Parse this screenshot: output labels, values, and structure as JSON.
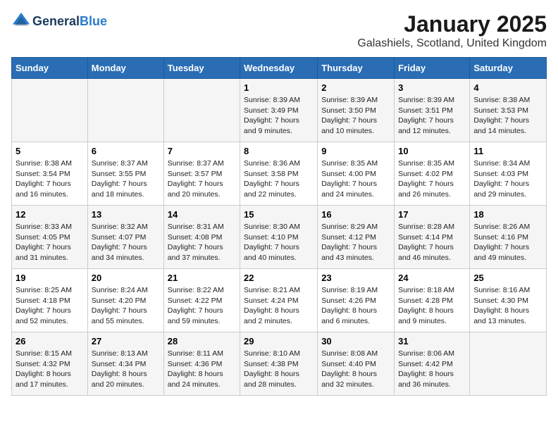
{
  "header": {
    "logo_general": "General",
    "logo_blue": "Blue",
    "month": "January 2025",
    "location": "Galashiels, Scotland, United Kingdom"
  },
  "weekdays": [
    "Sunday",
    "Monday",
    "Tuesday",
    "Wednesday",
    "Thursday",
    "Friday",
    "Saturday"
  ],
  "weeks": [
    [
      {
        "date": "",
        "sunrise": "",
        "sunset": "",
        "daylight": ""
      },
      {
        "date": "",
        "sunrise": "",
        "sunset": "",
        "daylight": ""
      },
      {
        "date": "",
        "sunrise": "",
        "sunset": "",
        "daylight": ""
      },
      {
        "date": "1",
        "sunrise": "Sunrise: 8:39 AM",
        "sunset": "Sunset: 3:49 PM",
        "daylight": "Daylight: 7 hours and 9 minutes."
      },
      {
        "date": "2",
        "sunrise": "Sunrise: 8:39 AM",
        "sunset": "Sunset: 3:50 PM",
        "daylight": "Daylight: 7 hours and 10 minutes."
      },
      {
        "date": "3",
        "sunrise": "Sunrise: 8:39 AM",
        "sunset": "Sunset: 3:51 PM",
        "daylight": "Daylight: 7 hours and 12 minutes."
      },
      {
        "date": "4",
        "sunrise": "Sunrise: 8:38 AM",
        "sunset": "Sunset: 3:53 PM",
        "daylight": "Daylight: 7 hours and 14 minutes."
      }
    ],
    [
      {
        "date": "5",
        "sunrise": "Sunrise: 8:38 AM",
        "sunset": "Sunset: 3:54 PM",
        "daylight": "Daylight: 7 hours and 16 minutes."
      },
      {
        "date": "6",
        "sunrise": "Sunrise: 8:37 AM",
        "sunset": "Sunset: 3:55 PM",
        "daylight": "Daylight: 7 hours and 18 minutes."
      },
      {
        "date": "7",
        "sunrise": "Sunrise: 8:37 AM",
        "sunset": "Sunset: 3:57 PM",
        "daylight": "Daylight: 7 hours and 20 minutes."
      },
      {
        "date": "8",
        "sunrise": "Sunrise: 8:36 AM",
        "sunset": "Sunset: 3:58 PM",
        "daylight": "Daylight: 7 hours and 22 minutes."
      },
      {
        "date": "9",
        "sunrise": "Sunrise: 8:35 AM",
        "sunset": "Sunset: 4:00 PM",
        "daylight": "Daylight: 7 hours and 24 minutes."
      },
      {
        "date": "10",
        "sunrise": "Sunrise: 8:35 AM",
        "sunset": "Sunset: 4:02 PM",
        "daylight": "Daylight: 7 hours and 26 minutes."
      },
      {
        "date": "11",
        "sunrise": "Sunrise: 8:34 AM",
        "sunset": "Sunset: 4:03 PM",
        "daylight": "Daylight: 7 hours and 29 minutes."
      }
    ],
    [
      {
        "date": "12",
        "sunrise": "Sunrise: 8:33 AM",
        "sunset": "Sunset: 4:05 PM",
        "daylight": "Daylight: 7 hours and 31 minutes."
      },
      {
        "date": "13",
        "sunrise": "Sunrise: 8:32 AM",
        "sunset": "Sunset: 4:07 PM",
        "daylight": "Daylight: 7 hours and 34 minutes."
      },
      {
        "date": "14",
        "sunrise": "Sunrise: 8:31 AM",
        "sunset": "Sunset: 4:08 PM",
        "daylight": "Daylight: 7 hours and 37 minutes."
      },
      {
        "date": "15",
        "sunrise": "Sunrise: 8:30 AM",
        "sunset": "Sunset: 4:10 PM",
        "daylight": "Daylight: 7 hours and 40 minutes."
      },
      {
        "date": "16",
        "sunrise": "Sunrise: 8:29 AM",
        "sunset": "Sunset: 4:12 PM",
        "daylight": "Daylight: 7 hours and 43 minutes."
      },
      {
        "date": "17",
        "sunrise": "Sunrise: 8:28 AM",
        "sunset": "Sunset: 4:14 PM",
        "daylight": "Daylight: 7 hours and 46 minutes."
      },
      {
        "date": "18",
        "sunrise": "Sunrise: 8:26 AM",
        "sunset": "Sunset: 4:16 PM",
        "daylight": "Daylight: 7 hours and 49 minutes."
      }
    ],
    [
      {
        "date": "19",
        "sunrise": "Sunrise: 8:25 AM",
        "sunset": "Sunset: 4:18 PM",
        "daylight": "Daylight: 7 hours and 52 minutes."
      },
      {
        "date": "20",
        "sunrise": "Sunrise: 8:24 AM",
        "sunset": "Sunset: 4:20 PM",
        "daylight": "Daylight: 7 hours and 55 minutes."
      },
      {
        "date": "21",
        "sunrise": "Sunrise: 8:22 AM",
        "sunset": "Sunset: 4:22 PM",
        "daylight": "Daylight: 7 hours and 59 minutes."
      },
      {
        "date": "22",
        "sunrise": "Sunrise: 8:21 AM",
        "sunset": "Sunset: 4:24 PM",
        "daylight": "Daylight: 8 hours and 2 minutes."
      },
      {
        "date": "23",
        "sunrise": "Sunrise: 8:19 AM",
        "sunset": "Sunset: 4:26 PM",
        "daylight": "Daylight: 8 hours and 6 minutes."
      },
      {
        "date": "24",
        "sunrise": "Sunrise: 8:18 AM",
        "sunset": "Sunset: 4:28 PM",
        "daylight": "Daylight: 8 hours and 9 minutes."
      },
      {
        "date": "25",
        "sunrise": "Sunrise: 8:16 AM",
        "sunset": "Sunset: 4:30 PM",
        "daylight": "Daylight: 8 hours and 13 minutes."
      }
    ],
    [
      {
        "date": "26",
        "sunrise": "Sunrise: 8:15 AM",
        "sunset": "Sunset: 4:32 PM",
        "daylight": "Daylight: 8 hours and 17 minutes."
      },
      {
        "date": "27",
        "sunrise": "Sunrise: 8:13 AM",
        "sunset": "Sunset: 4:34 PM",
        "daylight": "Daylight: 8 hours and 20 minutes."
      },
      {
        "date": "28",
        "sunrise": "Sunrise: 8:11 AM",
        "sunset": "Sunset: 4:36 PM",
        "daylight": "Daylight: 8 hours and 24 minutes."
      },
      {
        "date": "29",
        "sunrise": "Sunrise: 8:10 AM",
        "sunset": "Sunset: 4:38 PM",
        "daylight": "Daylight: 8 hours and 28 minutes."
      },
      {
        "date": "30",
        "sunrise": "Sunrise: 8:08 AM",
        "sunset": "Sunset: 4:40 PM",
        "daylight": "Daylight: 8 hours and 32 minutes."
      },
      {
        "date": "31",
        "sunrise": "Sunrise: 8:06 AM",
        "sunset": "Sunset: 4:42 PM",
        "daylight": "Daylight: 8 hours and 36 minutes."
      },
      {
        "date": "",
        "sunrise": "",
        "sunset": "",
        "daylight": ""
      }
    ]
  ]
}
